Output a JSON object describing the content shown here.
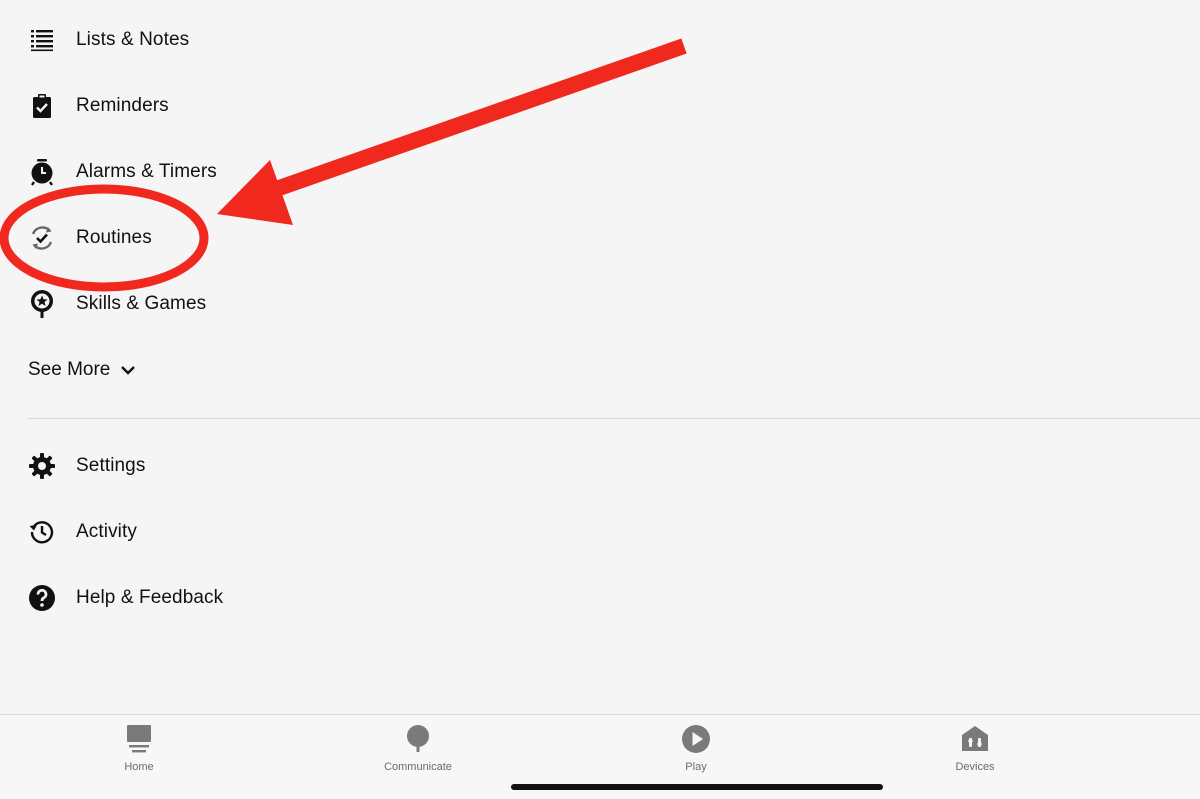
{
  "menu": {
    "items": [
      {
        "label": "Lists & Notes",
        "icon": "list-icon"
      },
      {
        "label": "Reminders",
        "icon": "clipboard-check-icon"
      },
      {
        "label": "Alarms & Timers",
        "icon": "alarm-clock-icon"
      },
      {
        "label": "Routines",
        "icon": "routine-refresh-check-icon"
      },
      {
        "label": "Skills & Games",
        "icon": "skills-star-bubble-icon"
      }
    ],
    "see_more_label": "See More",
    "secondary_items": [
      {
        "label": "Settings",
        "icon": "gear-icon"
      },
      {
        "label": "Activity",
        "icon": "history-clock-icon"
      },
      {
        "label": "Help & Feedback",
        "icon": "help-question-icon"
      }
    ]
  },
  "bottom_nav": {
    "tabs": [
      {
        "label": "Home",
        "icon": "home-icon"
      },
      {
        "label": "Communicate",
        "icon": "chat-bubble-icon"
      },
      {
        "label": "Play",
        "icon": "play-icon"
      },
      {
        "label": "Devices",
        "icon": "devices-house-icon"
      }
    ]
  },
  "colors": {
    "background": "#f5f5f5",
    "annotation_red": "#f0281e",
    "nav_icon_gray": "#7a7a7a"
  }
}
